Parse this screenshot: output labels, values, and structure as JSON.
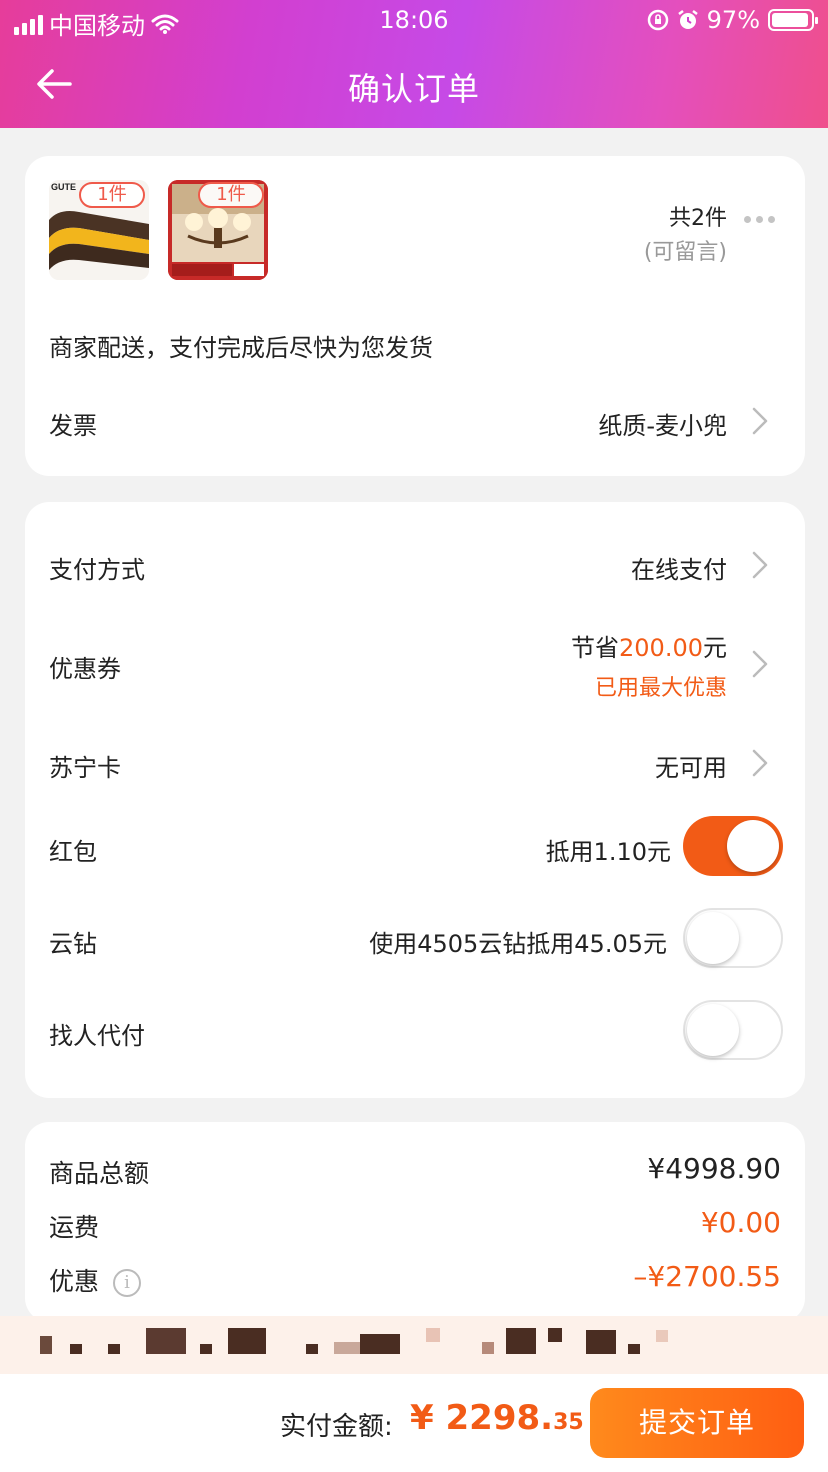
{
  "status_bar": {
    "carrier": "中国移动",
    "time": "18:06",
    "battery": "97%"
  },
  "nav": {
    "title": "确认订单"
  },
  "order_items": {
    "products": [
      {
        "qty_badge": "1件"
      },
      {
        "qty_badge": "1件"
      }
    ],
    "total_count": "共2件",
    "leave_message": "(可留言)",
    "delivery_note": "商家配送，支付完成后尽快为您发货",
    "invoice_label": "发票",
    "invoice_value": "纸质-麦小兜"
  },
  "payment": {
    "method_label": "支付方式",
    "method_value": "在线支付",
    "coupon_label": "优惠券",
    "coupon_save_prefix": "节省",
    "coupon_save_amount": "200.00",
    "coupon_save_suffix": "元",
    "coupon_note": "已用最大优惠",
    "card_label": "苏宁卡",
    "card_value": "无可用",
    "redpacket_label": "红包",
    "redpacket_value": "抵用1.10元",
    "redpacket_on": true,
    "diamond_label": "云钻",
    "diamond_value": "使用4505云钻抵用45.05元",
    "diamond_on": false,
    "proxy_label": "找人代付",
    "proxy_on": false
  },
  "summary": {
    "goods_total_label": "商品总额",
    "goods_total_value": "¥4998.90",
    "shipping_label": "运费",
    "shipping_value": "¥0.00",
    "discount_label": "优惠",
    "discount_value": "–¥2700.55"
  },
  "footer": {
    "pay_label": "实付金额:",
    "currency": "¥",
    "amount_main": "2298.",
    "amount_cents": "35",
    "submit_label": "提交订单"
  },
  "colors": {
    "accent": "#f25b16",
    "header_gradient": [
      "#e63d9a",
      "#c64ae6",
      "#ef4f8c"
    ]
  }
}
